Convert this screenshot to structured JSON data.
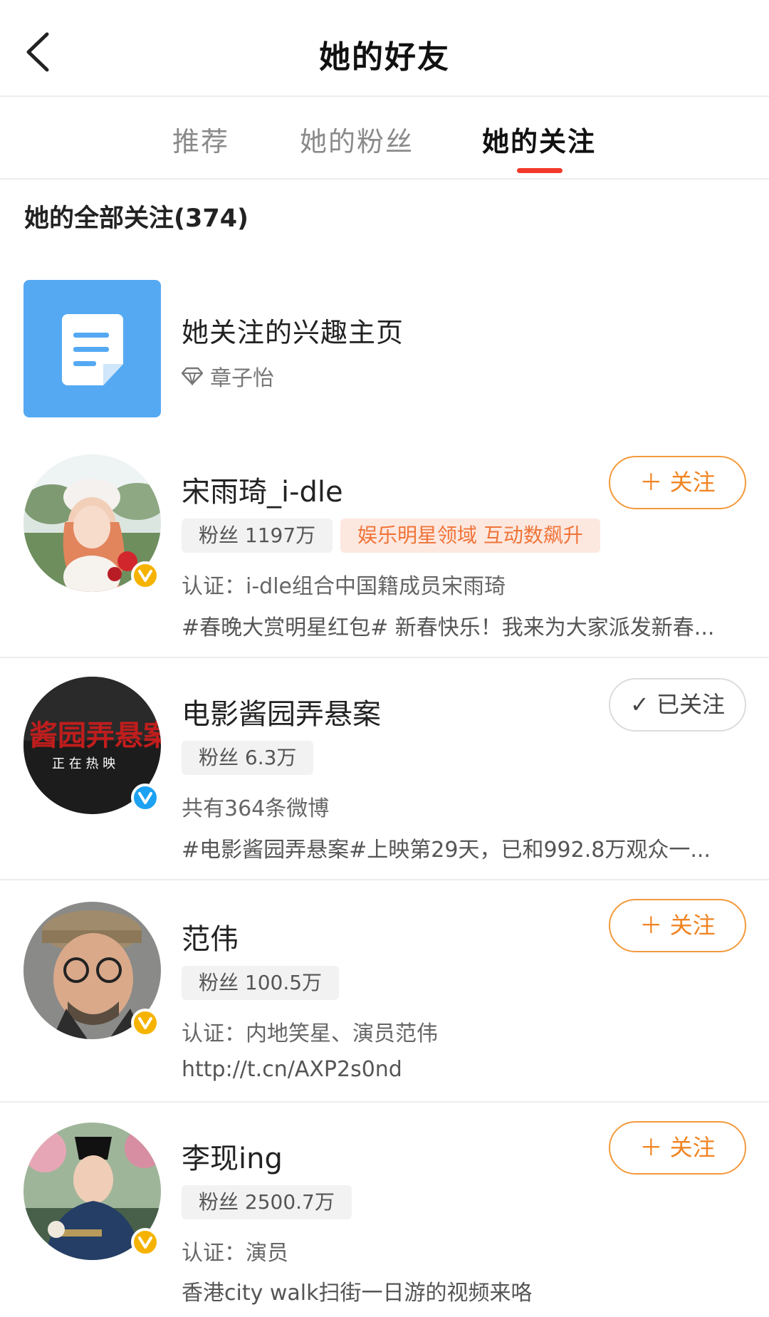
{
  "header": {
    "title": "她的好友"
  },
  "tabs": [
    {
      "label": "推荐"
    },
    {
      "label": "她的粉丝"
    },
    {
      "label": "她的关注",
      "active": true
    }
  ],
  "section_title": "她的全部关注(374)",
  "interest_page": {
    "title": "她关注的兴趣主页",
    "owner": "章子怡",
    "icon": "document-icon"
  },
  "users": [
    {
      "name": "宋雨琦_i-dle",
      "fans": "粉丝 1197万",
      "tag": "娱乐明星领域 互动数飙升",
      "verify": "认证：i-dle组合中国籍成员宋雨琦",
      "desc": "#春晚大赏明星红包# 新春快乐！我来为大家派发新春...",
      "button": "＋ 关注",
      "followed": false,
      "badge_color": "#f5b300"
    },
    {
      "name": "电影酱园弄悬案",
      "fans": "粉丝 6.3万",
      "avatar_text": "酱园弄悬案",
      "avatar_sub": "正 在 热 映",
      "verify": "共有364条微博",
      "desc": "#电影酱园弄悬案#上映第29天，已和992.8万观众一...",
      "button": "✓ 已关注",
      "followed": true,
      "badge_color": "#1da1f2"
    },
    {
      "name": "范伟",
      "fans": "粉丝 100.5万",
      "verify": "认证：内地笑星、演员范伟",
      "desc": "http://t.cn/AXP2s0nd",
      "button": "＋ 关注",
      "followed": false,
      "badge_color": "#f5b300"
    },
    {
      "name": "李现ing",
      "fans": "粉丝 2500.7万",
      "verify": "认证：演员",
      "desc": "香港city walk扫街一日游的视频来咯",
      "button": "＋ 关注",
      "followed": false,
      "badge_color": "#f5b300"
    }
  ],
  "colors": {
    "accent": "#f08422",
    "tab_indicator": "#f23a2b",
    "interest_bg": "#55a9f3"
  }
}
